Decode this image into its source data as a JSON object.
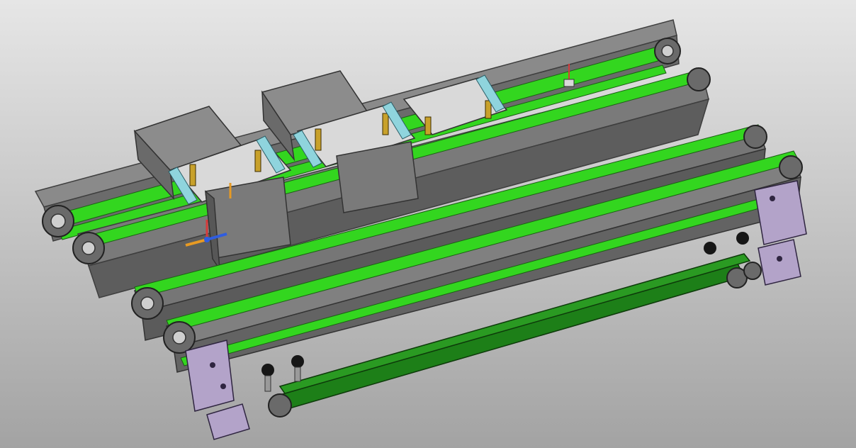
{
  "scene": {
    "background_top": "#e6e6e6",
    "background_bottom": "#a3a3a3",
    "frame_gray": "#7b7b7b",
    "frame_dark": "#4c4c4c",
    "frame_light": "#a9a9a9",
    "belt_green": "#33d61f",
    "belt_dark_green": "#1d7f18",
    "bracket_purple": "#b3a3c9",
    "tooling_cyan": "#8fd4dd",
    "tooling_gold": "#c8a12b",
    "knob_black": "#161616",
    "axis_red": "#d63b3b",
    "axis_blue": "#2f5de0",
    "axis_orange": "#e79a23"
  }
}
